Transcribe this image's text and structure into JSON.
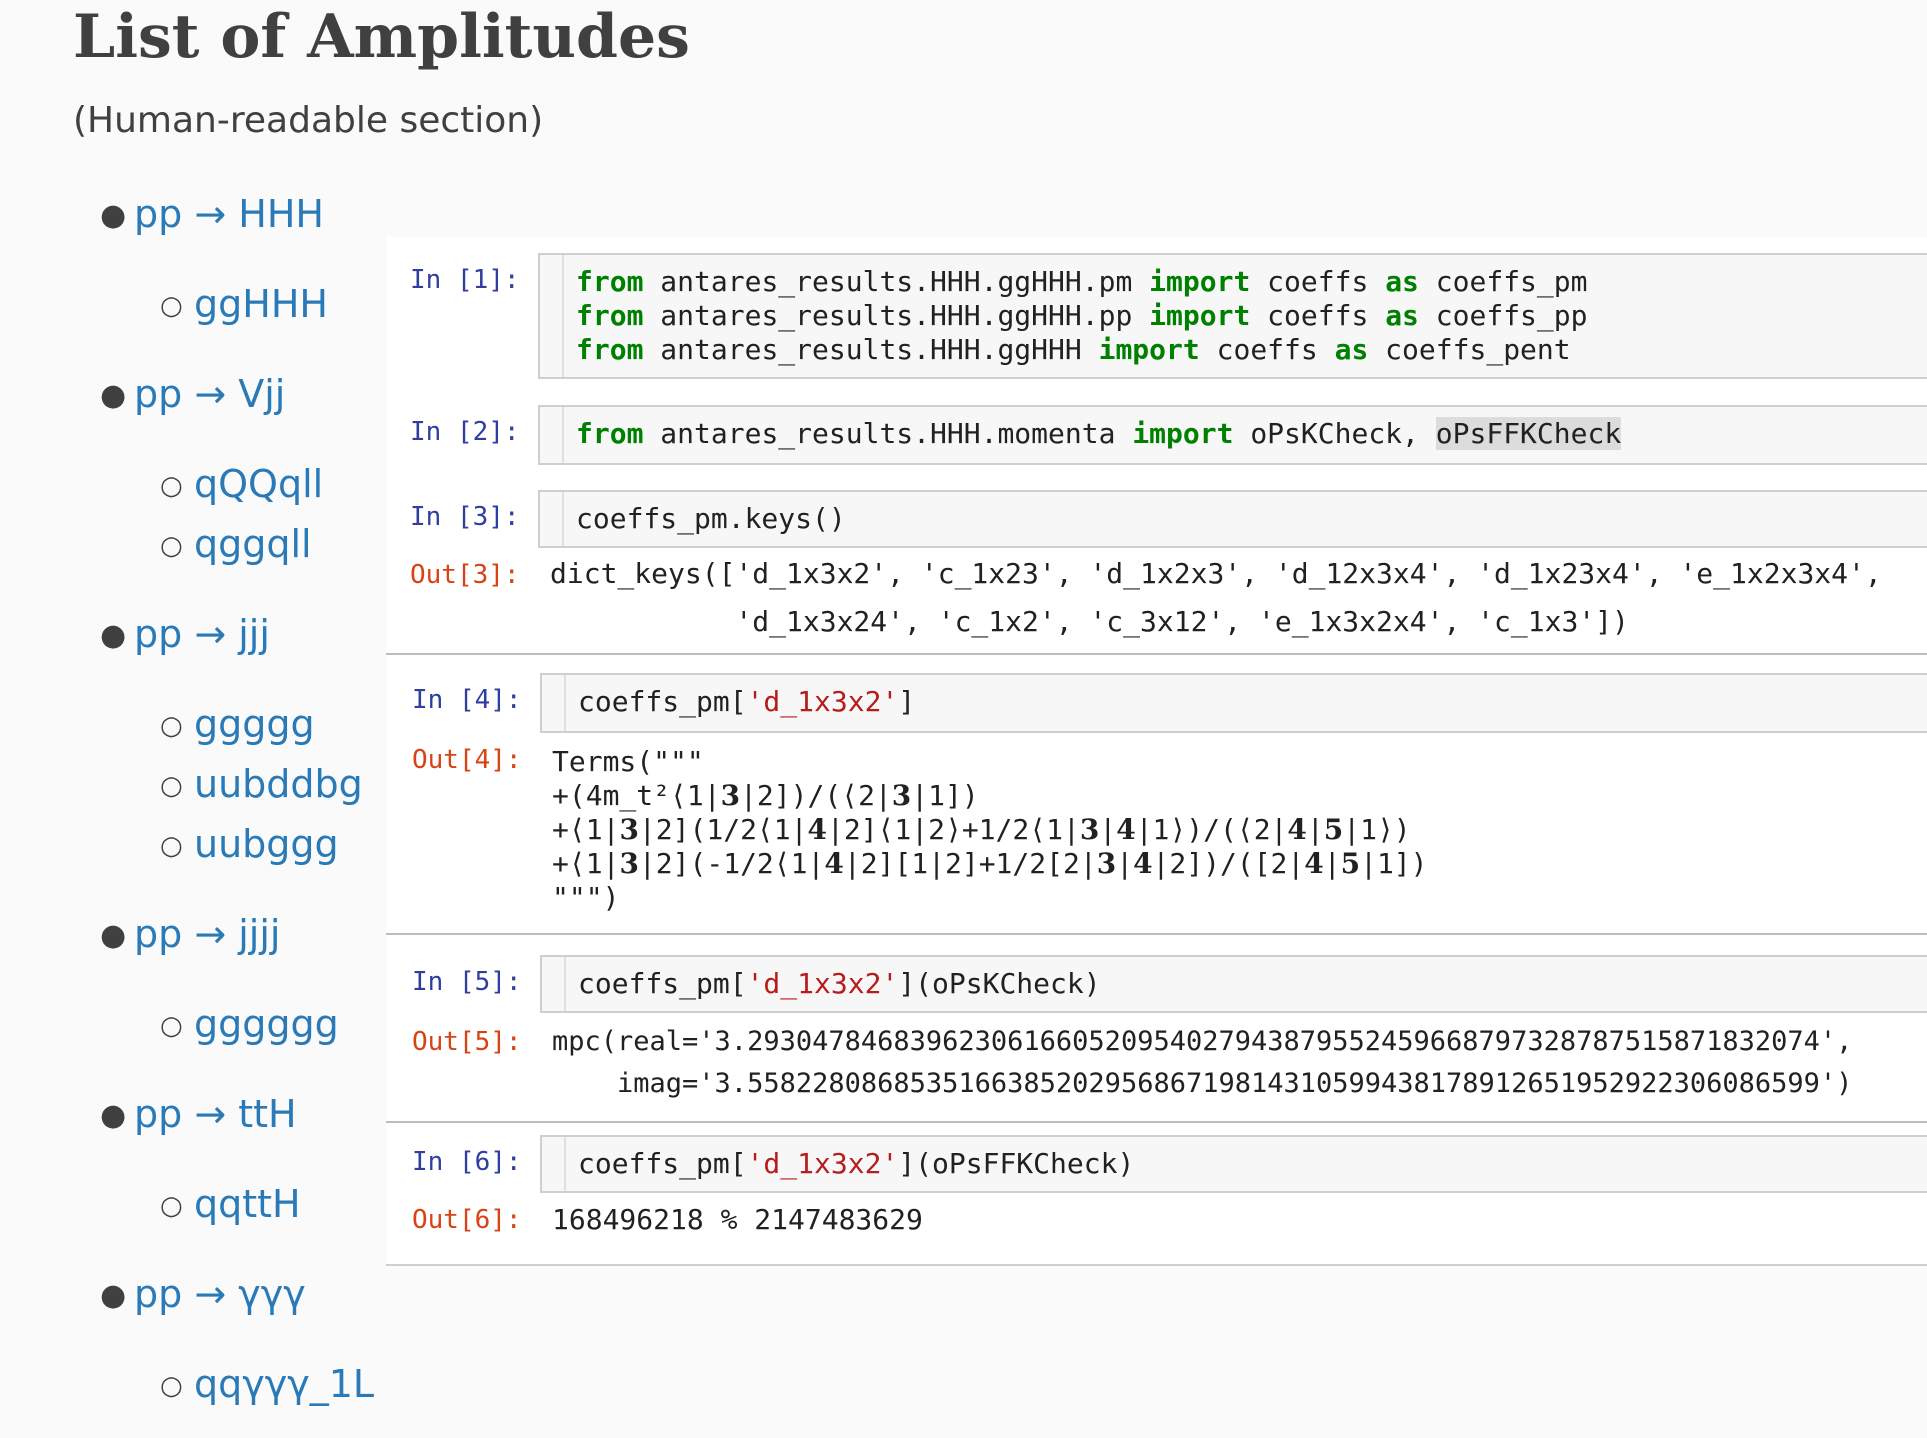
{
  "header": {
    "title": "List of Amplitudes",
    "subtitle": "(Human-readable section)"
  },
  "nav": {
    "items": [
      {
        "level": 1,
        "label": "pp → HHH"
      },
      {
        "level": 2,
        "label": "ggHHH"
      },
      {
        "level": 1,
        "label": "pp → Vjj"
      },
      {
        "level": 2,
        "label": "qQQqll"
      },
      {
        "level": 2,
        "label": "qggqll"
      },
      {
        "level": 1,
        "label": "pp → jjj"
      },
      {
        "level": 2,
        "label": "ggggg"
      },
      {
        "level": 2,
        "label": "uubddbg"
      },
      {
        "level": 2,
        "label": "uubggg"
      },
      {
        "level": 1,
        "label": "pp → jjjj"
      },
      {
        "level": 2,
        "label": "gggggg"
      },
      {
        "level": 1,
        "label": "pp → ttH"
      },
      {
        "level": 2,
        "label": "qqttH"
      },
      {
        "level": 1,
        "label": "pp → γγγ"
      },
      {
        "level": 2,
        "label": "qqγγγ_1L"
      }
    ]
  },
  "notebook": {
    "cells": [
      {
        "in_prompt": "In [1]:",
        "code_lines": [
          "from antares_results.HHH.ggHHH.pm import coeffs as coeffs_pm",
          "from antares_results.HHH.ggHHH.pp import coeffs as coeffs_pp",
          "from antares_results.HHH.ggHHH import coeffs as coeffs_pent"
        ]
      },
      {
        "in_prompt": "In [2]:",
        "code_lines": [
          "from antares_results.HHH.momenta import oPsKCheck, oPsFFKCheck"
        ]
      },
      {
        "in_prompt": "In [3]:",
        "code_lines": [
          "coeffs_pm.keys()"
        ],
        "out_prompt": "Out[3]:",
        "output_lines": [
          "dict_keys(['d_1x3x2', 'c_1x23', 'd_1x2x3', 'd_12x3x4', 'd_1x23x4', 'e_1x2x3x4',",
          "           'd_1x3x24', 'c_1x2', 'c_3x12', 'e_1x3x2x4', 'c_1x3'])"
        ]
      },
      {
        "in_prompt": "In [4]:",
        "code_lines": [
          "coeffs_pm['d_1x3x2']"
        ],
        "out_prompt": "Out[4]:",
        "output_lines": [
          "Terms(\"\"\"",
          "+(4m_t²⟨1|3|2])/(⟨2|3|1])",
          "+⟨1|3|2](1/2⟨1|4|2]⟨1|2⟩+1/2⟨1|3|4|1⟩)/(⟨2|4|5|1⟩)",
          "+⟨1|3|2](-1/2⟨1|4|2][1|2]+1/2[2|3|4|2])/([2|4|5|1])",
          "\"\"\")"
        ]
      },
      {
        "in_prompt": "In [5]:",
        "code_lines": [
          "coeffs_pm['d_1x3x2'](oPsKCheck)"
        ],
        "out_prompt": "Out[5]:",
        "output_lines": [
          "mpc(real='3.29304784683962306166052095402794387955245966879732878751587183207​4',",
          "    imag='3.558228086853516638520295686719814310599438178912651952922306086599')"
        ]
      },
      {
        "in_prompt": "In [6]:",
        "code_lines": [
          "coeffs_pm['d_1x3x2'](oPsFFKCheck)"
        ],
        "out_prompt": "Out[6]:",
        "output_lines": [
          "168496218 % 2147483629"
        ]
      }
    ]
  }
}
